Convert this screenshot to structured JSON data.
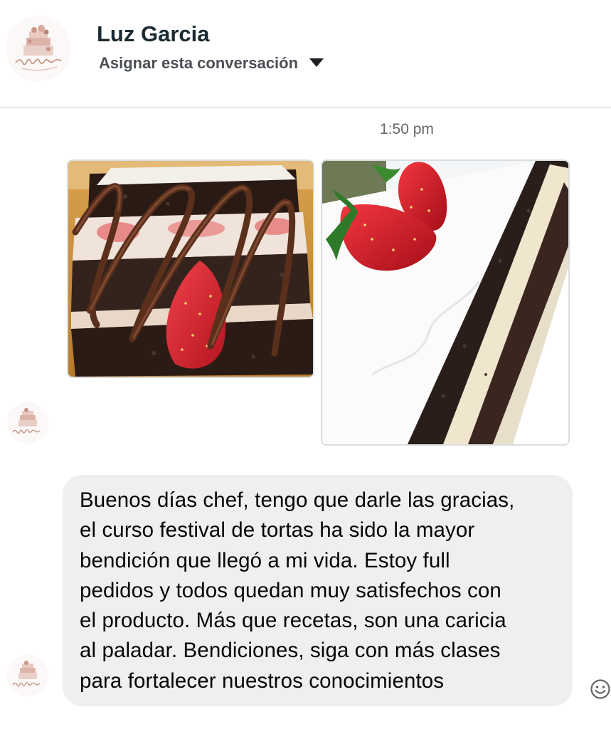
{
  "header": {
    "contact_name": "Luz Garcia",
    "assign_label": "Asignar esta conversación",
    "avatar_brand": "Yarina",
    "avatar_icon": "cake-logo-icon"
  },
  "conversation": {
    "timestamp": "1:50 pm",
    "photos": [
      {
        "name": "chocolate-strawberry-cake-photo",
        "subject": "cake slice"
      },
      {
        "name": "white-cream-layer-cake-photo",
        "subject": "cake slice"
      }
    ],
    "message": {
      "lines": [
        "Buenos días chef, tengo que darle las gracias,",
        "el curso festival de tortas ha sido la mayor",
        "bendición que llegó a mi vida. Estoy full",
        "pedidos y todos quedan muy satisfechos con",
        "el producto. Más que recetas, son una caricia",
        "al paladar. Bendiciones, siga con más clases",
        "para fortalecer nuestros conocimientos"
      ]
    },
    "sender_avatar_brand": "Yarina",
    "react_icon": "smiley-face-icon"
  },
  "colors": {
    "bubble_bg": "#efefef",
    "divider": "#e4e6eb",
    "muted_text": "#65676b",
    "name_text": "#1c2b33"
  }
}
